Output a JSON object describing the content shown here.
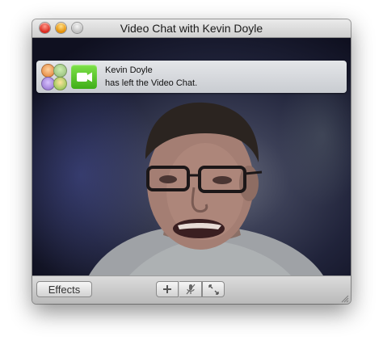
{
  "window": {
    "title": "Video Chat with Kevin Doyle",
    "traffic_lights": [
      "close",
      "minimize",
      "zoom"
    ]
  },
  "notification": {
    "name": "Kevin Doyle",
    "message": "has left the Video Chat.",
    "icons": [
      "buddy-avatars-icon",
      "video-camera-icon"
    ],
    "camera_icon_color": "#4cbf22"
  },
  "toolbar": {
    "effects_label": "Effects",
    "controls": [
      "add-participant-icon",
      "mute-microphone-icon",
      "fullscreen-icon"
    ]
  },
  "colors": {
    "titlebar": "#d6d6d6",
    "close": "#d8241a",
    "minimize": "#e38b00"
  }
}
